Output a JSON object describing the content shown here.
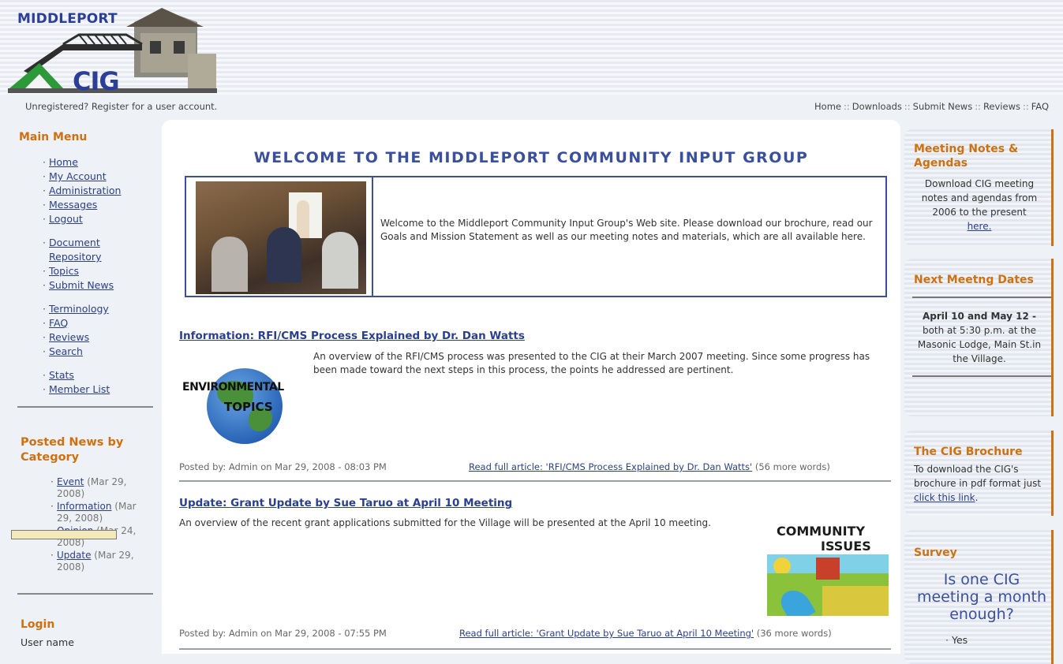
{
  "header": {
    "logo_top": "MIDDLEPORT",
    "logo_bottom": "CIG",
    "unregistered_text": "Unregistered? Register for a user account.",
    "top_nav": [
      "Home",
      "Downloads",
      "Submit News",
      "Reviews",
      "FAQ"
    ],
    "nav_separator": "::"
  },
  "left": {
    "main_menu_title": "Main Menu",
    "group1": [
      "Home",
      "My Account",
      "Administration",
      "Messages",
      "Logout"
    ],
    "group2": [
      "Document",
      "Repository",
      "Topics",
      "Submit News"
    ],
    "group3": [
      "Terminology",
      "FAQ",
      "Reviews",
      "Search"
    ],
    "group4": [
      "Stats",
      "Member List"
    ],
    "news_title_1": "Posted News by",
    "news_title_2": "Category",
    "categories": [
      {
        "name": "Event",
        "date_1": " (Mar 29,",
        "date_2": "2008)"
      },
      {
        "name": "Information",
        "date_1": " (Mar",
        "date_2": "29, 2008)"
      },
      {
        "name": "Opinion",
        "date_1": " (Mar 24,",
        "date_2": "2008)"
      },
      {
        "name": "Update",
        "date_1": " (Mar 29,",
        "date_2": "2008)"
      }
    ],
    "login_title": "Login",
    "username_label": "User name"
  },
  "center": {
    "welcome_title": "WELCOME TO THE MIDDLEPORT COMMUNITY INPUT GROUP",
    "welcome_text": "Welcome to the Middleport Community Input Group's Web site. Please download our brochure, read our Goals and Mission Statement as well as our meeting notes and materials, which are all available here.",
    "articles": [
      {
        "title": "Information: RFI/CMS Process Explained by Dr. Dan Watts",
        "body": "An overview of the RFI/CMS process was presented to the CIG at their March 2007 meeting. Since some progress has been made toward the next steps in this process, the points he addressed are pertinent.",
        "image_text_1": "ENVIRONMENTAL",
        "image_text_2": "TOPICS",
        "posted": "Posted by: Admin on Mar 29, 2008 - 08:03 PM",
        "read_more": "Read full article: 'RFI/CMS Process Explained by Dr. Dan Watts'",
        "more_words": " (56 more words)"
      },
      {
        "title": "Update: Grant Update by Sue Taruo at April 10 Meeting",
        "body": "An overview of the recent grant applications submitted for the Village will be presented at the April 10 meeting.",
        "image_text_1": "COMMUNITY",
        "image_text_2": "ISSUES",
        "posted": "Posted by: Admin on Mar 29, 2008 - 07:55 PM",
        "read_more": "Read full article: 'Grant Update by Sue Taruo at April 10 Meeting'",
        "more_words": " (36 more words)"
      }
    ]
  },
  "right": {
    "notes_title_1": "Meeting Notes &",
    "notes_title_2": "Agendas",
    "notes_text": "Download CIG meeting notes and agendas from 2006 to the present",
    "notes_link": "here.",
    "dates_title": "Next Meetng Dates",
    "dates_bold": "April 10 and May 12 -",
    "dates_text": "both at 5:30 p.m. at the Masonic Lodge, Main St.in the Village.",
    "brochure_title": "The CIG Brochure",
    "brochure_text": "To download the CIG's brochure in pdf format just",
    "brochure_link": "click this link",
    "brochure_end": ".",
    "survey_title": "Survey",
    "survey_question": "Is one CIG meeting a month enough?",
    "survey_options": [
      "Yes"
    ]
  },
  "colors": {
    "accent_orange": "#d1700f",
    "link_blue": "#2a3f8f",
    "title_blue": "#3b4f9f"
  }
}
